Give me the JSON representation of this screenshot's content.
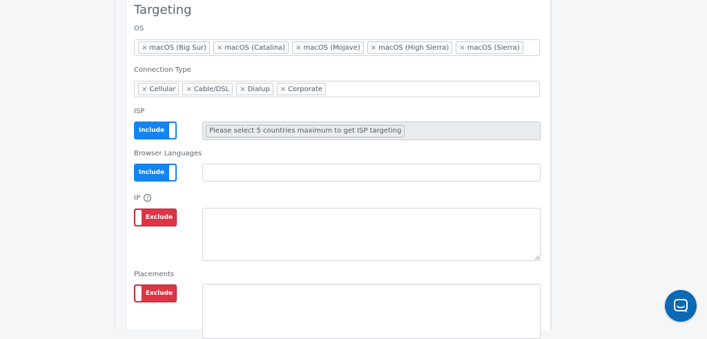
{
  "section": {
    "title": "Targeting"
  },
  "os": {
    "label": "OS",
    "tags": [
      "macOS (Big Sur)",
      "macOS (Catalina)",
      "macOS (Mojave)",
      "macOS (High Sierra)",
      "macOS (Sierra)"
    ],
    "remove_glyph": "×"
  },
  "connection": {
    "label": "Connection Type",
    "tags": [
      "Cellular",
      "Cable/DSL",
      "Dialup",
      "Corporate"
    ],
    "remove_glyph": "×"
  },
  "isp": {
    "label": "ISP",
    "toggle": "Include",
    "disabled_text": "Please select 5 countries maximum to get ISP targeting"
  },
  "browser_languages": {
    "label": "Browser Languages",
    "toggle": "Include",
    "value": ""
  },
  "ip": {
    "label": "IP",
    "help": "?",
    "toggle": "Exclude",
    "value": ""
  },
  "placements": {
    "label": "Placements",
    "toggle": "Exclude",
    "value": ""
  },
  "colors": {
    "include": "#1584f0",
    "exclude": "#dc3545",
    "chat": "#0b6ab3"
  },
  "icons": {
    "chat": "chat-bubble-icon"
  }
}
